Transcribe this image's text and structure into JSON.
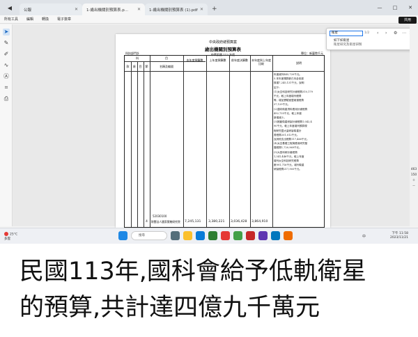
{
  "browser": {
    "back_icon": "arrow-left-icon",
    "tabs": [
      {
        "label": "公報",
        "active": false
      },
      {
        "label": "1-歲出機關別預算表.p...",
        "active": true
      },
      {
        "label": "1-歲出機關別預算表 (1).pdf",
        "active": false
      }
    ],
    "new_tab": "+",
    "window_controls": [
      "—",
      "□",
      "✕"
    ]
  },
  "toolbar": {
    "items": [
      "所有工具",
      "編輯",
      "轉換",
      "電子簽章"
    ],
    "share_label": "共用"
  },
  "left_tools": [
    "cursor-icon",
    "comment-icon",
    "highlight-icon",
    "draw-icon",
    "text-icon",
    "crop-icon",
    "stamp-icon"
  ],
  "document": {
    "header_line1": "中央政府總預算案",
    "header_line2": "歲出機關別預算表",
    "header_line3": "中華民國 113 年度",
    "agency": "科技部門計",
    "unit": "單位：新臺幣千元",
    "columns": {
      "group": "科",
      "item": "目",
      "sub1": "款",
      "sub2": "項",
      "sub3": "目",
      "sub4": "節",
      "name": "名稱及編號",
      "budget_this_year": "本年度預算數",
      "budget_last_year": "上年度預算數",
      "final_prev": "前年度決算數",
      "diff": "本年度與上年度比較",
      "notes": "說明"
    },
    "notes_lines": [
      "年度減列$45,720千元。",
      "5.本年度預算數已內含依據",
      "核增7,245,131千元，說明",
      "如下：",
      "(1)太空科技研究計畫經費310,179",
      "千元，較上年度增列經費",
      "等，增加實驗室暨維運經費",
      "37,129千元。",
      "(2)邁向衛星資料應用計畫經費",
      "492,735千元，較上年度",
      "新增減少。",
      "(3)推動衛星研製計畫經費1,042,4",
      "90千元，較上年度增列預算規",
      "程研究暨大量研製衛星計",
      "書經費201,012千元。",
      "及其他支出經費117,460千元。",
      "(4)太空基礎工程與應用研究發",
      "展經費1,720,969千元。",
      "(5)大型科研計畫經費",
      "1,341,446千元，較上年度",
      "增列太空科技研究經費",
      "數991,716千元，增列衛星",
      "研製經費217,905千元。"
    ],
    "row": {
      "code": "52030100",
      "index": "4",
      "name": "財團法人國家實驗研究院",
      "budget_this_year": "7,245,131",
      "budget_last_year": "3,380,221",
      "final_prev": "3,036,428",
      "diff": "3,864,910"
    }
  },
  "find_panel": {
    "query": "衛星",
    "count": "1/2",
    "result_title": "如下如衛星",
    "result_sub": "衛星研究及衛星研製"
  },
  "zoom_level": "463",
  "zoom_other": "150",
  "taskbar": {
    "weather_temp": "25°C",
    "weather_text": "多雲",
    "search_placeholder": "搜尋",
    "time": "下午 11:58",
    "date": "2023/11/21",
    "tray_lang": "中"
  },
  "caption_line1": "民國113年,國科會給予低軌衛星",
  "caption_line2": "的預算,共計達四億九千萬元",
  "colors": {
    "accent": "#1a73e8",
    "share_bg": "#1a1a1a",
    "taskbar_bg": "#eef0f4"
  }
}
